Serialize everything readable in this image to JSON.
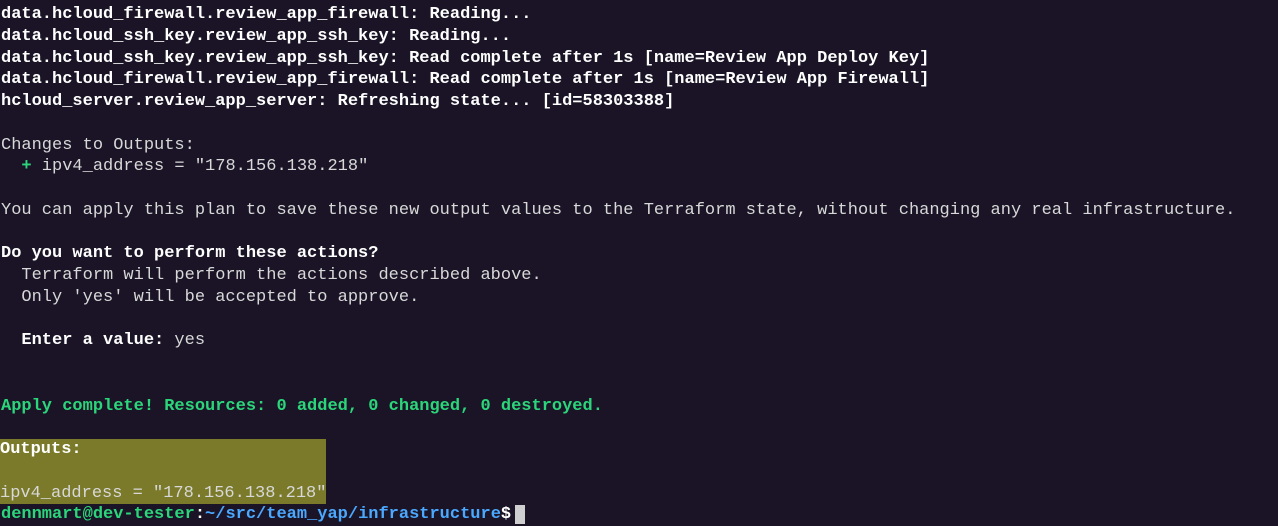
{
  "reads": {
    "firewall_reading": "data.hcloud_firewall.review_app_firewall: Reading...",
    "sshkey_reading": "data.hcloud_ssh_key.review_app_ssh_key: Reading...",
    "sshkey_complete": "data.hcloud_ssh_key.review_app_ssh_key: Read complete after 1s [name=Review App Deploy Key]",
    "firewall_complete": "data.hcloud_firewall.review_app_firewall: Read complete after 1s [name=Review App Firewall]",
    "server_refresh": "hcloud_server.review_app_server: Refreshing state... [id=58303388]"
  },
  "changes": {
    "header": "Changes to Outputs:",
    "plus": "+",
    "output_line": " ipv4_address = \"178.156.138.218\""
  },
  "note": "You can apply this plan to save these new output values to the Terraform state, without changing any real infrastructure.",
  "confirm": {
    "question": "Do you want to perform these actions?",
    "line1": "  Terraform will perform the actions described above.",
    "line2": "  Only 'yes' will be accepted to approve.",
    "enter_prefix": "  ",
    "enter_label": "Enter a value:",
    "entered": " yes"
  },
  "apply_complete": "Apply complete! Resources: 0 added, 0 changed, 0 destroyed.",
  "outputs": {
    "header": "Outputs:",
    "line": "ipv4_address = \"178.156.138.218\""
  },
  "prompt": {
    "userhost": "dennmart@dev-tester",
    "colon": ":",
    "path": "~/src/team_yap/infrastructure",
    "dollar": "$"
  }
}
